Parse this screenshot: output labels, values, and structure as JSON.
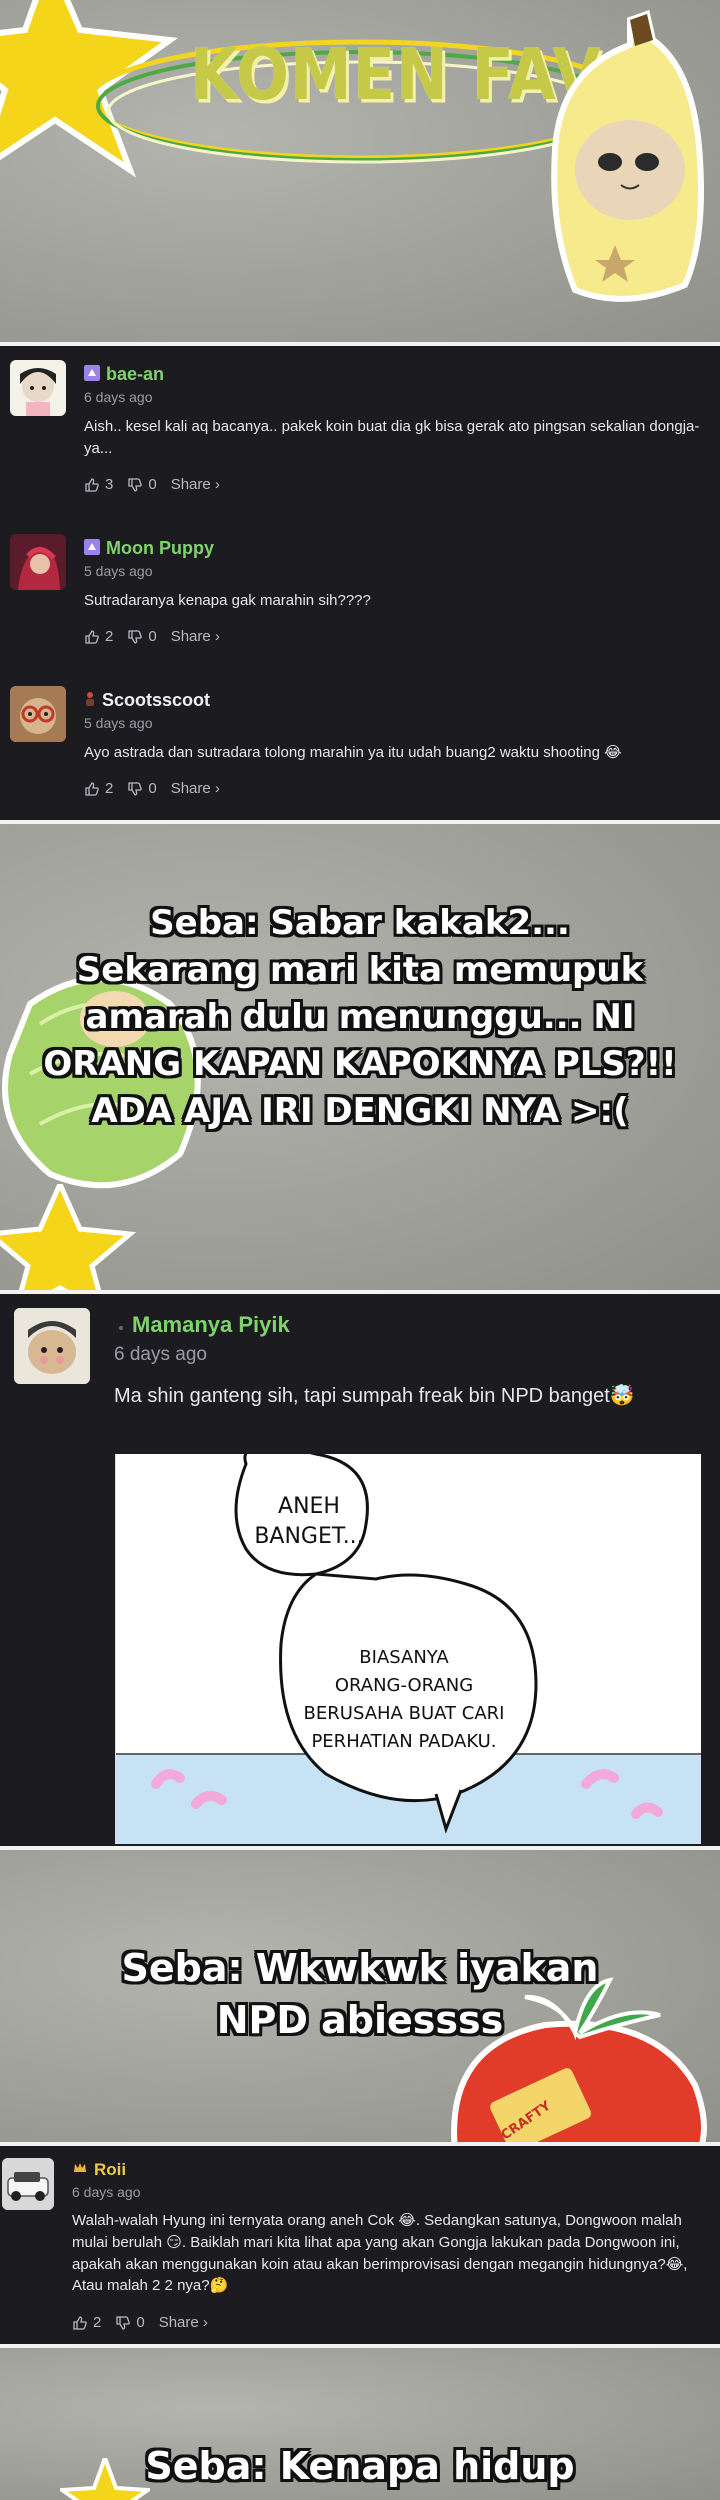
{
  "header": {
    "title": "KOMEN FAV"
  },
  "comments": [
    {
      "username": "bae-an",
      "time": "6 days ago",
      "text": "Aish.. kesel kali aq bacanya.. pakek koin buat dia gk bisa gerak ato pingsan sekalian dongja-ya...",
      "likes": "3",
      "dislikes": "0",
      "share": "Share ›"
    },
    {
      "username": "Moon Puppy",
      "time": "5 days ago",
      "text": "Sutradaranya kenapa gak marahin sih????",
      "likes": "2",
      "dislikes": "0",
      "share": "Share ›"
    },
    {
      "username": "Scootsscoot",
      "time": "5 days ago",
      "text": "Ayo astrada dan sutradara tolong marahin ya itu udah buang2 waktu shooting 😂",
      "likes": "2",
      "dislikes": "0",
      "share": "Share ›"
    },
    {
      "username": "Mamanya Piyik",
      "time": "6 days ago",
      "text": "Ma shin ganteng sih, tapi sumpah freak bin NPD banget🤯"
    },
    {
      "username": "Roii",
      "time": "6 days ago",
      "text": "Walah-walah Hyung ini ternyata orang aneh Cok 😂. Sedangkan satunya, Dongwoon malah mulai berulah 😏. Baiklah mari kita lihat apa yang akan Gongja lakukan pada Dongwoon ini, apakah akan menggunakan koin atau akan berimprovisasi dengan megangin hidungnya?😂, Atau malah 2 2 nya?🤔",
      "likes": "2",
      "dislikes": "0",
      "share": "Share ›"
    }
  ],
  "captions": {
    "first": [
      "Seba: Sabar kakak2...",
      "Sekarang mari kita memupuk",
      "amarah dulu menunggu... NI",
      "ORANG KAPAN KAPOKNYA  PLS?!!",
      "ADA AJA IRI DENGKI NYA >:("
    ],
    "second": [
      "Seba: Wkwkwk iyakan",
      "NPD abiessss"
    ],
    "third": [
      "Seba: Kenapa hidup"
    ]
  },
  "comic": {
    "bubble_top": [
      "ANEH",
      "BANGET..."
    ],
    "bubble_bottom": [
      "BIASANYA",
      "ORANG-ORANG",
      "BERUSAHA BUAT CARI",
      "PERHATIAN PADAKU."
    ]
  },
  "sticker_text": "CRAFTY",
  "colors": {
    "username": "#7fd36b",
    "title": "#c6c947",
    "dark_bg": "#1c1b20"
  }
}
